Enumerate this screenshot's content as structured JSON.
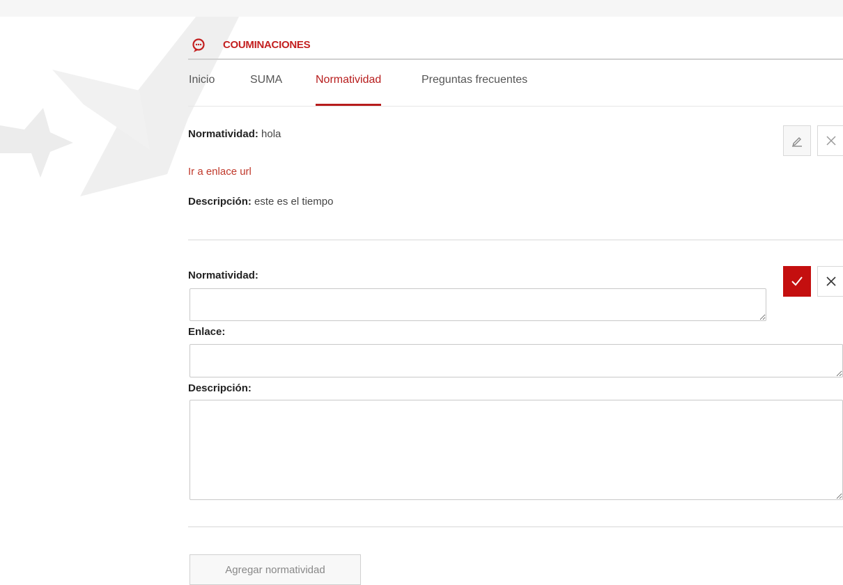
{
  "section": {
    "title": "COUMINACIONES",
    "icon": "chat-bubble-icon",
    "accent": "#c31f1f"
  },
  "tabs": [
    {
      "label": "Inicio",
      "active": false
    },
    {
      "label": "SUMA",
      "active": false
    },
    {
      "label": "Normatividad",
      "active": true
    },
    {
      "label": "Preguntas frecuentes",
      "active": false
    }
  ],
  "record": {
    "name_label": "Normatividad:",
    "name_value": "hola",
    "link_text": "Ir a enlace url",
    "desc_label": "Descripción:",
    "desc_value": "este es el tiempo",
    "edit_icon": "pencil-icon",
    "delete_icon": "close-icon"
  },
  "form": {
    "normatividad_label": "Normatividad:",
    "normatividad_value": "",
    "enlace_label": "Enlace:",
    "enlace_value": "",
    "descripcion_label": "Descripción:",
    "descripcion_value": "",
    "confirm_icon": "check-icon",
    "cancel_icon": "close-icon",
    "confirm_color": "#c40f0f"
  },
  "add_button": {
    "label": "Agregar normatividad"
  }
}
